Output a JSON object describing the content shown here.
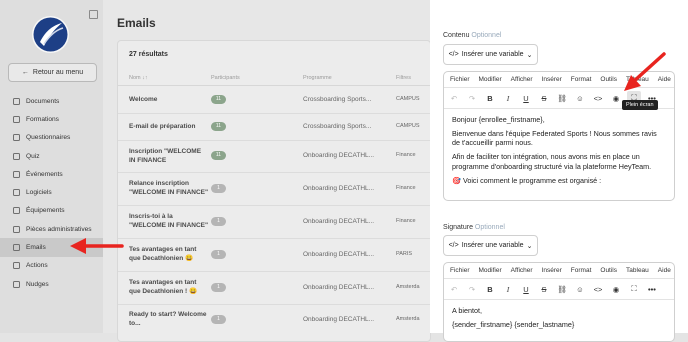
{
  "sidebar": {
    "back_label": "Retour au menu",
    "items": [
      {
        "label": "Documents",
        "icon": "document-icon"
      },
      {
        "label": "Formations",
        "icon": "book-icon"
      },
      {
        "label": "Questionnaires",
        "icon": "questionnaire-icon"
      },
      {
        "label": "Quiz",
        "icon": "quiz-icon"
      },
      {
        "label": "Événements",
        "icon": "people-icon"
      },
      {
        "label": "Logiciels",
        "icon": "software-icon"
      },
      {
        "label": "Équipements",
        "icon": "equipment-icon"
      },
      {
        "label": "Pièces administratives",
        "icon": "file-icon"
      },
      {
        "label": "Emails",
        "icon": "mail-icon",
        "active": true
      },
      {
        "label": "Actions",
        "icon": "actions-icon"
      },
      {
        "label": "Nudges",
        "icon": "nudge-icon"
      }
    ]
  },
  "main": {
    "title": "Emails",
    "count": "27 résultats",
    "columns": {
      "name": "Nom ↓↑",
      "participants": "Participants",
      "program": "Programme",
      "filters": "Filtres"
    },
    "rows": [
      {
        "name": "Welcome",
        "participants": "11",
        "program": "Crossboarding Sports...",
        "filters": "CAMPUS"
      },
      {
        "name": "E-mail de préparation",
        "participants": "11",
        "program": "Crossboarding Sports...",
        "filters": "CAMPUS"
      },
      {
        "name": "Inscription \"WELCOME IN FINANCE",
        "participants": "11",
        "program": "Onboarding DECATHL...",
        "filters": "Finance"
      },
      {
        "name": "Relance inscription \"WELCOME IN FINANCE\"",
        "participants": "1",
        "program": "Onboarding DECATHL...",
        "filters": "Finance"
      },
      {
        "name": "Inscris-toi à la \"WELCOME IN FINANCE\"",
        "participants": "1",
        "program": "Onboarding DECATHL...",
        "filters": "Finance"
      },
      {
        "name": "Tes avantages en tant que Decathlonien 😀",
        "participants": "1",
        "program": "Onboarding DECATHL...",
        "filters": "PARIS"
      },
      {
        "name": "Tes avantages en tant que Decathlonien ! 😀",
        "participants": "1",
        "program": "Onboarding DECATHL...",
        "filters": "Amsterda"
      },
      {
        "name": "Ready to start? Welcome to...",
        "participants": "1",
        "program": "Onboarding DECATHL...",
        "filters": "Amsterda"
      }
    ]
  },
  "panel": {
    "content_label": "Contenu",
    "optional": "Optionnel",
    "variable_btn": "Insérer une variable",
    "menus": [
      "Fichier",
      "Modifier",
      "Afficher",
      "Insérer",
      "Format",
      "Outils",
      "Tableau",
      "Aide"
    ],
    "tooltip": "Plein écran",
    "content": [
      "Bonjour {enrollee_firstname},",
      "Bienvenue dans l'équipe Federated Sports ! Nous sommes ravis de t'accueillir parmi nous.",
      "Afin de faciliter ton intégration, nous avons mis en place un programme d'onboarding structuré via la plateforme HeyTeam.",
      "🎯 Voici comment le programme est organisé :"
    ],
    "signature_label": "Signature",
    "signature_content": [
      "A bientot,",
      "{sender_firstname} {sender_lastname}"
    ]
  },
  "colors": {
    "arrow": "#e8241f",
    "active_nav": "#c9c9c9",
    "optional": "#99aabb"
  }
}
